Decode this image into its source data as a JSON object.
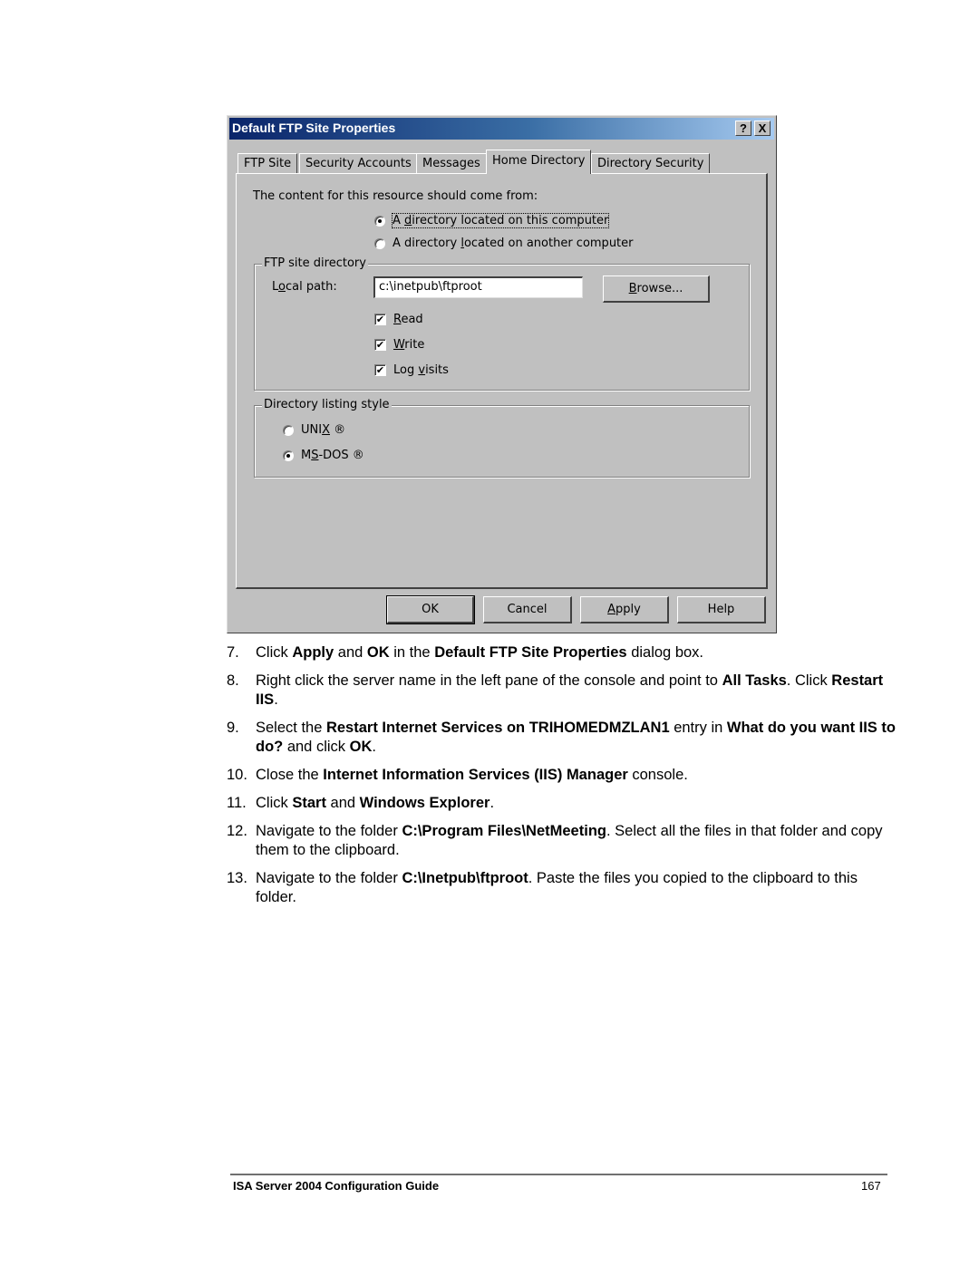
{
  "dialog": {
    "title": "Default FTP Site Properties",
    "help_button": "?",
    "close_button": "X",
    "tabs": [
      {
        "label": "FTP Site",
        "active": false
      },
      {
        "label": "Security Accounts",
        "active": false
      },
      {
        "label": "Messages",
        "active": false
      },
      {
        "label": "Home Directory",
        "active": true
      },
      {
        "label": "Directory Security",
        "active": false
      }
    ],
    "content_source": {
      "prompt": "The content for this resource should come from:",
      "options": [
        {
          "label_pre": "A ",
          "label_key": "d",
          "label_post": "irectory located on this computer",
          "selected": true
        },
        {
          "label_pre": "A directory ",
          "label_key": "l",
          "label_post": "ocated on another computer",
          "selected": false
        }
      ]
    },
    "ftp_site_directory": {
      "legend": "FTP site directory",
      "local_path_label_pre": "L",
      "local_path_label_key": "o",
      "local_path_label_post": "cal path:",
      "local_path_value": "c:\\inetpub\\ftproot",
      "browse_key": "B",
      "browse_post": "rowse...",
      "checkboxes": [
        {
          "key": "R",
          "post": "ead",
          "pre": "",
          "checked": true
        },
        {
          "key": "W",
          "post": "rite",
          "pre": "",
          "checked": true
        },
        {
          "key": "v",
          "post": "isits",
          "pre": "Log ",
          "checked": true
        }
      ]
    },
    "listing_style": {
      "legend": "Directory listing style",
      "options": [
        {
          "pre": "UNI",
          "key": "X",
          "post": " ®",
          "selected": false
        },
        {
          "pre": "M",
          "key": "S",
          "post": "-DOS ®",
          "selected": true
        }
      ]
    },
    "buttons": {
      "ok": "OK",
      "cancel": "Cancel",
      "apply_key": "A",
      "apply_post": "pply",
      "help": "Help"
    }
  },
  "steps": [
    {
      "num": "7.",
      "parts": [
        [
          "Click ",
          false
        ],
        [
          "Apply",
          true
        ],
        [
          " and ",
          false
        ],
        [
          "OK",
          true
        ],
        [
          " in the ",
          false
        ],
        [
          "Default FTP Site Properties",
          true
        ],
        [
          " dialog box.",
          false
        ]
      ]
    },
    {
      "num": "8.",
      "parts": [
        [
          "Right click the server name in the left pane of the console and point to ",
          false
        ],
        [
          "All Tasks",
          true
        ],
        [
          ". Click ",
          false
        ],
        [
          "Restart IIS",
          true
        ],
        [
          ".",
          false
        ]
      ]
    },
    {
      "num": "9.",
      "parts": [
        [
          "Select the ",
          false
        ],
        [
          "Restart Internet Services on TRIHOMEDMZLAN1",
          true
        ],
        [
          " entry in ",
          false
        ],
        [
          "What do you want IIS to do?",
          true
        ],
        [
          " and click ",
          false
        ],
        [
          "OK",
          true
        ],
        [
          ".",
          false
        ]
      ]
    },
    {
      "num": "10.",
      "parts": [
        [
          "Close the ",
          false
        ],
        [
          "Internet Information Services (IIS) Manager",
          true
        ],
        [
          " console.",
          false
        ]
      ]
    },
    {
      "num": "11.",
      "parts": [
        [
          "Click ",
          false
        ],
        [
          "Start",
          true
        ],
        [
          " and ",
          false
        ],
        [
          "Windows Explorer",
          true
        ],
        [
          ".",
          false
        ]
      ]
    },
    {
      "num": "12.",
      "parts": [
        [
          "Navigate to the folder ",
          false
        ],
        [
          "C:\\Program Files\\NetMeeting",
          true
        ],
        [
          ". Select all the files in that folder and copy them to the clipboard.",
          false
        ]
      ]
    },
    {
      "num": "13.",
      "parts": [
        [
          "Navigate to the folder ",
          false
        ],
        [
          "C:\\Inetpub\\ftproot",
          true
        ],
        [
          ". Paste the files you copied to the clipboard to this folder.",
          false
        ]
      ]
    }
  ],
  "footer": {
    "title": "ISA Server 2004 Configuration Guide",
    "page": "167"
  }
}
